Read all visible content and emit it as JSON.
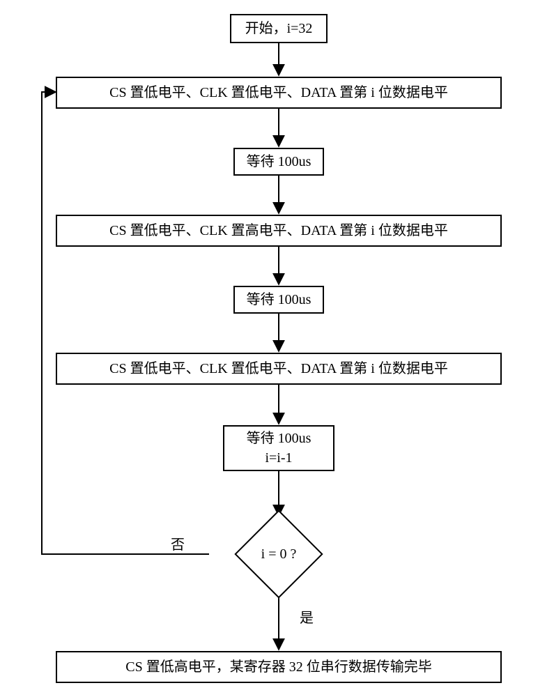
{
  "flow": {
    "start": "开始，i=32",
    "step1": "CS 置低电平、CLK 置低电平、DATA 置第 i 位数据电平",
    "wait1": "等待 100us",
    "step2": "CS 置低电平、CLK 置高电平、DATA 置第 i 位数据电平",
    "wait2": "等待 100us",
    "step3": "CS 置低电平、CLK 置低电平、DATA 置第 i 位数据电平",
    "wait3": "等待 100us\ni=i-1",
    "decision": "i = 0 ?",
    "no_label": "否",
    "yes_label": "是",
    "end": "CS 置低高电平，某寄存器 32 位串行数据传输完毕"
  }
}
